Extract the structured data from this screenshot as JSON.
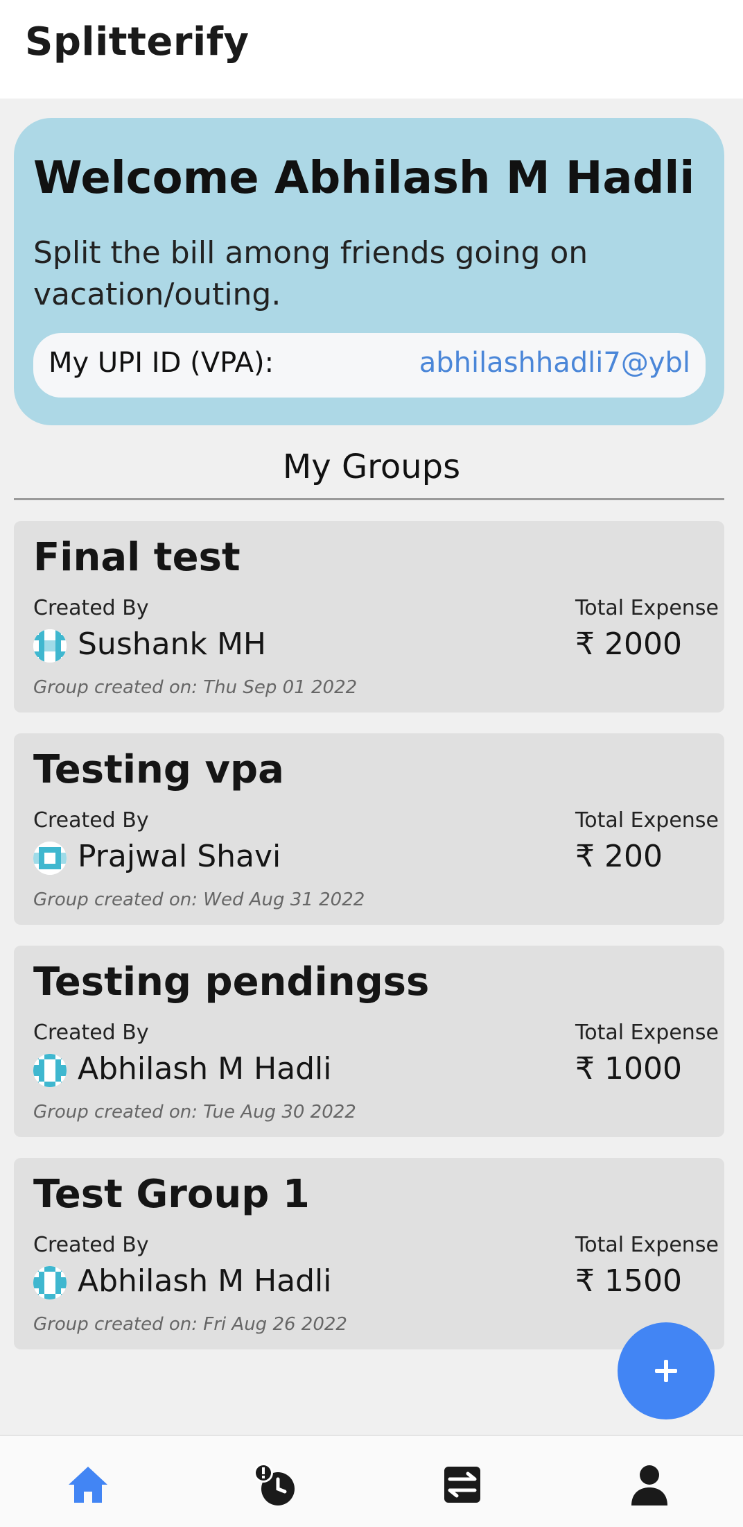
{
  "app": {
    "title": "Splitterify"
  },
  "welcome": {
    "heading": "Welcome Abhilash M Hadli",
    "subtitle": "Split the bill among friends going on vacation/outing.",
    "upi_label": "My UPI ID (VPA):",
    "upi_value": "abhilashhadli7@ybl"
  },
  "groups_section": {
    "title": "My Groups"
  },
  "groups": [
    {
      "name": "Final test",
      "created_by_label": "Created By",
      "creator": "Sushank MH",
      "total_expense_label": "Total Expense",
      "amount": "₹ 2000",
      "date": "Group created on: Thu Sep 01 2022"
    },
    {
      "name": "Testing vpa",
      "created_by_label": "Created By",
      "creator": "Prajwal Shavi",
      "total_expense_label": "Total Expense",
      "amount": "₹ 200",
      "date": "Group created on: Wed Aug 31 2022"
    },
    {
      "name": "Testing pendingss",
      "created_by_label": "Created By",
      "creator": "Abhilash M Hadli",
      "total_expense_label": "Total Expense",
      "amount": "₹ 1000",
      "date": "Group created on: Tue Aug 30 2022"
    },
    {
      "name": "Test Group 1",
      "created_by_label": "Created By",
      "creator": "Abhilash M Hadli",
      "total_expense_label": "Total Expense",
      "amount": "₹ 1500",
      "date": "Group created on: Fri Aug 26 2022"
    }
  ],
  "fab": {
    "icon": "plus-icon"
  },
  "bottom_nav": {
    "items": [
      {
        "icon": "home-icon",
        "active": true
      },
      {
        "icon": "pending-clock-icon",
        "active": false
      },
      {
        "icon": "transactions-icon",
        "active": false
      },
      {
        "icon": "profile-icon",
        "active": false
      }
    ]
  },
  "colors": {
    "accent": "#4285f4",
    "welcome_bg": "#add8e6",
    "upi_text": "#4a86d8",
    "card_bg": "#e0e0e0"
  }
}
